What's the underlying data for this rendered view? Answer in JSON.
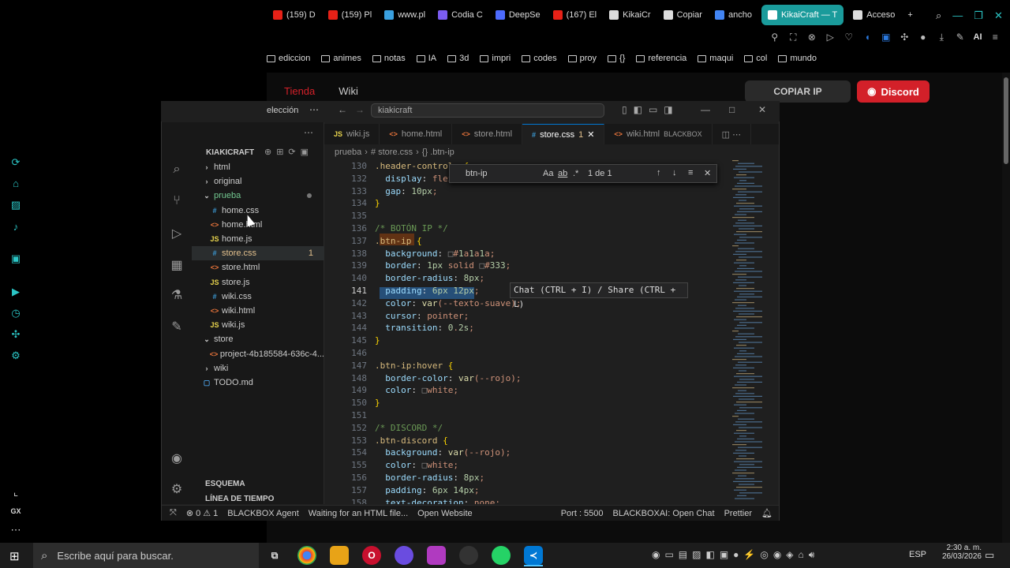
{
  "browser": {
    "tabs": [
      {
        "label": "(159) D",
        "color": "#e62117"
      },
      {
        "label": "(159) Pl",
        "color": "#e62117"
      },
      {
        "label": "www.pl",
        "color": "#3aa0e0"
      },
      {
        "label": "Codia C",
        "color": "#7b5cf0"
      },
      {
        "label": "DeepSe",
        "color": "#4d6bfe"
      },
      {
        "label": "(167) El",
        "color": "#e62117"
      },
      {
        "label": "KikaiCr",
        "color": "#dddddd"
      },
      {
        "label": "Copiar",
        "color": "#dddddd"
      },
      {
        "label": "ancho",
        "color": "#4285f4"
      },
      {
        "label": "KikaiCraft — T",
        "color": "#ffffff",
        "active": true
      },
      {
        "label": "Acceso",
        "color": "#dddddd"
      }
    ],
    "new_tab": "+",
    "ai_label": "AI",
    "bookmarks": [
      "ediccion",
      "animes",
      "notas",
      "IA",
      "3d",
      "impri",
      "codes",
      "proy",
      "{}",
      "referencia",
      "maqui",
      "col",
      "mundo"
    ]
  },
  "site": {
    "nav": [
      "Tienda",
      "Wiki"
    ],
    "copy_ip": "COPIAR IP",
    "discord": "Discord",
    "accent": "#d32029"
  },
  "vscode": {
    "partial_title": "elección",
    "search": "kiakicraft",
    "explorer_root": "KIAKICRAFT",
    "files": [
      {
        "label": "html",
        "type": "folder-closed",
        "depth": 1
      },
      {
        "label": "original",
        "type": "folder-closed",
        "depth": 1
      },
      {
        "label": "prueba",
        "type": "folder-open",
        "depth": 1
      },
      {
        "label": "home.css",
        "type": "css",
        "depth": 2
      },
      {
        "label": "home.html",
        "type": "html",
        "depth": 2
      },
      {
        "label": "home.js",
        "type": "js",
        "depth": 2
      },
      {
        "label": "store.css",
        "type": "css",
        "depth": 2,
        "badge": "1",
        "selected": true
      },
      {
        "label": "store.html",
        "type": "html",
        "depth": 2
      },
      {
        "label": "store.js",
        "type": "js",
        "depth": 2
      },
      {
        "label": "wiki.css",
        "type": "css",
        "depth": 2
      },
      {
        "label": "wiki.html",
        "type": "html",
        "depth": 2
      },
      {
        "label": "wiki.js",
        "type": "js",
        "depth": 2
      },
      {
        "label": "store",
        "type": "folder-open",
        "depth": 1
      },
      {
        "label": "project-4b185584-636c-4...",
        "type": "html",
        "depth": 2
      },
      {
        "label": "wiki",
        "type": "folder-closed",
        "depth": 1
      },
      {
        "label": "TODO.md",
        "type": "md",
        "depth": 1
      }
    ],
    "outline": "ESQUEMA",
    "timeline": "LÍNEA DE TIEMPO",
    "tabs": [
      {
        "label": "wiki.js",
        "type": "js"
      },
      {
        "label": "home.html",
        "type": "html"
      },
      {
        "label": "store.html",
        "type": "html"
      },
      {
        "label": "store.css",
        "type": "css",
        "badge": "1",
        "active": true
      },
      {
        "label": "wiki.html",
        "type": "html",
        "suffix": "BLACKBOX"
      }
    ],
    "breadcrumb": [
      "prueba",
      "# store.css",
      "{} .btn-ip"
    ],
    "find": {
      "query": "btn-ip",
      "case": "Aa",
      "word": "ab",
      "regex": ".*",
      "count": "1 de 1"
    },
    "tooltip": "Chat (CTRL + I) / Share (CTRL + L)",
    "code": [
      {
        "n": "130",
        "t": ".header-controls {"
      },
      {
        "n": "132",
        "t": "  display: flex;"
      },
      {
        "n": "133",
        "t": "  gap: 10px;"
      },
      {
        "n": "134",
        "t": "}"
      },
      {
        "n": "135",
        "t": ""
      },
      {
        "n": "136",
        "t": "/* BOTÓN IP */"
      },
      {
        "n": "137",
        "t": ".btn-ip {"
      },
      {
        "n": "138",
        "t": "  background: ■#1a1a1a;"
      },
      {
        "n": "139",
        "t": "  border: 1px solid ■#333;"
      },
      {
        "n": "140",
        "t": "  border-radius: 8px;"
      },
      {
        "n": "141",
        "t": "  padding: 6px 12px;"
      },
      {
        "n": "142",
        "t": "  color: var(--texto-suave);"
      },
      {
        "n": "143",
        "t": "  cursor: pointer;"
      },
      {
        "n": "144",
        "t": "  transition: 0.2s;"
      },
      {
        "n": "145",
        "t": "}"
      },
      {
        "n": "146",
        "t": ""
      },
      {
        "n": "147",
        "t": ".btn-ip:hover {"
      },
      {
        "n": "148",
        "t": "  border-color: var(--rojo);"
      },
      {
        "n": "149",
        "t": "  color: ■white;"
      },
      {
        "n": "150",
        "t": "}"
      },
      {
        "n": "151",
        "t": ""
      },
      {
        "n": "152",
        "t": "/* DISCORD */"
      },
      {
        "n": "153",
        "t": ".btn-discord {"
      },
      {
        "n": "154",
        "t": "  background: var(--rojo);"
      },
      {
        "n": "155",
        "t": "  color: ■white;"
      },
      {
        "n": "156",
        "t": "  border-radius: 8px;"
      },
      {
        "n": "157",
        "t": "  padding: 6px 14px;"
      },
      {
        "n": "158",
        "t": "  text-decoration: none;"
      }
    ],
    "status": {
      "errors": "⊗ 0 ⚠ 1",
      "agent": "BLACKBOX Agent",
      "waiting": "Waiting for an HTML file...",
      "open_website": "Open Website",
      "port": "Port : 5500",
      "chat": "BLACKBOXAI: Open Chat",
      "prettier": "Prettier"
    }
  },
  "taskbar": {
    "search_placeholder": "Escribe aquí para buscar.",
    "lang": "ESP",
    "time": "2:30 a. m.",
    "date": "26/03/2026"
  }
}
